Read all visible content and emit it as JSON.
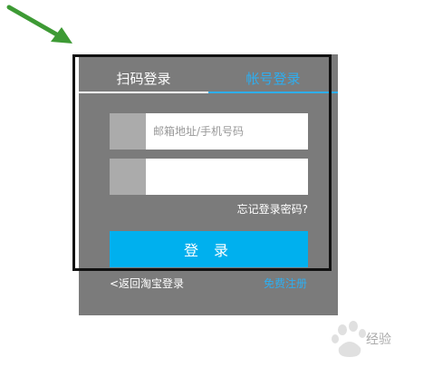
{
  "tabs": {
    "scan_label": "扫码登录",
    "account_label": "帐号登录"
  },
  "form": {
    "username_placeholder": "邮箱地址/手机号码",
    "password_value": "",
    "forgot_label": "忘记登录密码?",
    "login_label": "登 录"
  },
  "footer": {
    "back_label": "<返回淘宝登录",
    "register_label": "免费注册"
  },
  "watermark": {
    "text": "经验"
  },
  "colors": {
    "panel": "#7b7b7b",
    "accent": "#2eaef0",
    "button": "#00b0ee",
    "arrow": "#3d9a34",
    "frame": "#111111"
  }
}
